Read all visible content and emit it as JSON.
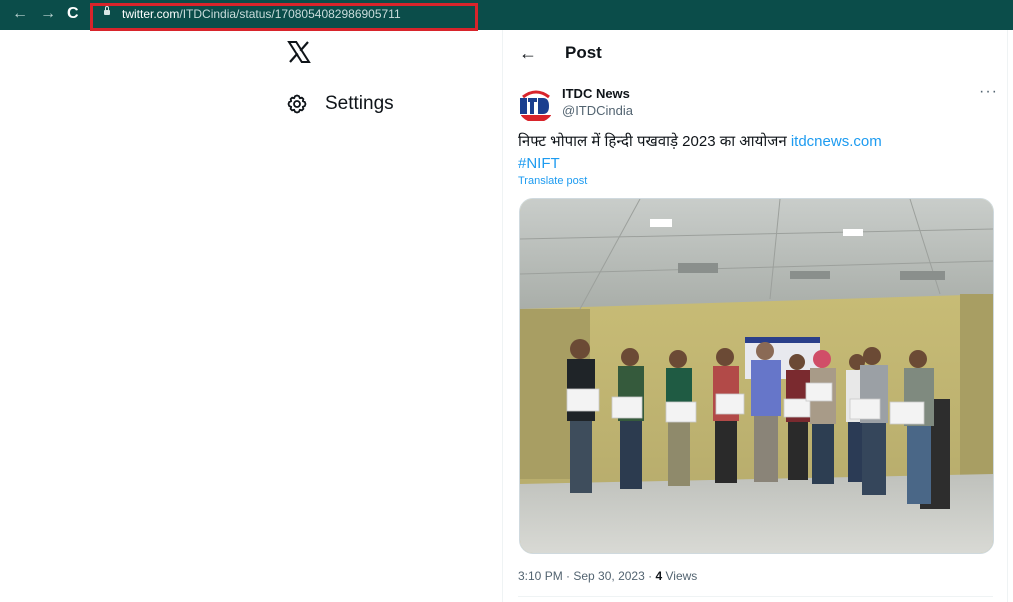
{
  "browser": {
    "url_host": "twitter.com",
    "url_path": "/ITDCindia/status/1708054082986905711",
    "icons": [
      "back-arrow-icon",
      "forward-arrow-icon",
      "reload-icon",
      "lock-icon"
    ]
  },
  "sidebar": {
    "logo": "x-logo",
    "settings_label": "Settings"
  },
  "header": {
    "title": "Post"
  },
  "post": {
    "author_name": "ITDC News",
    "author_handle": "@ITDCindia",
    "text_main": "निफ्ट भोपाल में हिन्दी पखवाड़े 2023 का आयोजन ",
    "text_link": "itdcnews.com",
    "hashtag": "#NIFT",
    "translate": "Translate post",
    "time": "3:10 PM",
    "date": "Sep 30, 2023",
    "views_count": "4",
    "views_label": "Views"
  },
  "colors": {
    "browser_bar": "#0b4d4a",
    "url_highlight": "#d8242b",
    "link": "#1d9bf0"
  }
}
